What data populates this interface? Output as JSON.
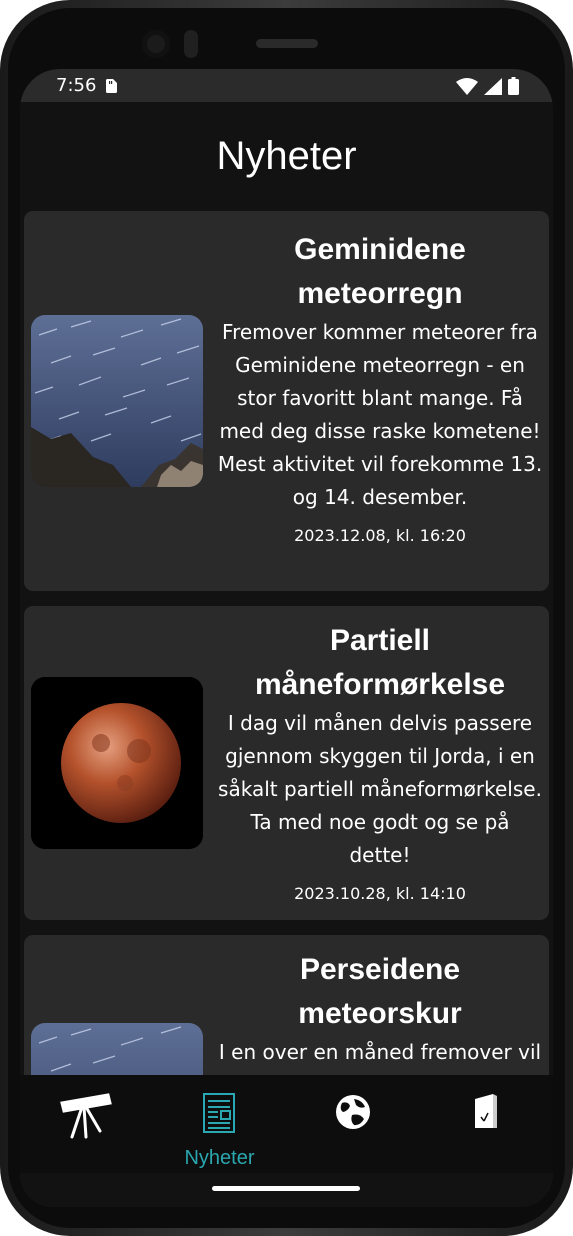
{
  "status_bar": {
    "time": "7:56",
    "icons": [
      "sim-card-icon",
      "wifi-icon",
      "signal-icon",
      "battery-icon"
    ]
  },
  "page": {
    "title": "Nyheter"
  },
  "news": [
    {
      "title": "Geminidene meteorregn",
      "body": "Fremover kommer meteorer fra Geminidene meteorregn - en stor favoritt blant mange. Få med deg disse raske kometene! Mest aktivitet vil forekomme 13. og 14. desember.",
      "date": "2023.12.08, kl. 16:20",
      "image": "star-trails-image"
    },
    {
      "title": "Partiell måneformørkelse",
      "body": "I dag vil månen delvis passere gjennom skyggen til Jorda, i en såkalt partiell måneformørkelse. Ta med noe godt og se på dette!",
      "date": "2023.10.28, kl. 14:10",
      "image": "blood-moon-image"
    },
    {
      "title": "Perseidene meteorskur",
      "body": "I en over en måned fremover vil",
      "date": "",
      "image": "star-trails-image"
    }
  ],
  "bottom_nav": {
    "active_index": 1,
    "active_color": "#2aa7b0",
    "items": [
      {
        "icon": "telescope-icon",
        "label": ""
      },
      {
        "icon": "newspaper-icon",
        "label": "Nyheter"
      },
      {
        "icon": "globe-icon",
        "label": ""
      },
      {
        "icon": "door-icon",
        "label": ""
      }
    ]
  }
}
